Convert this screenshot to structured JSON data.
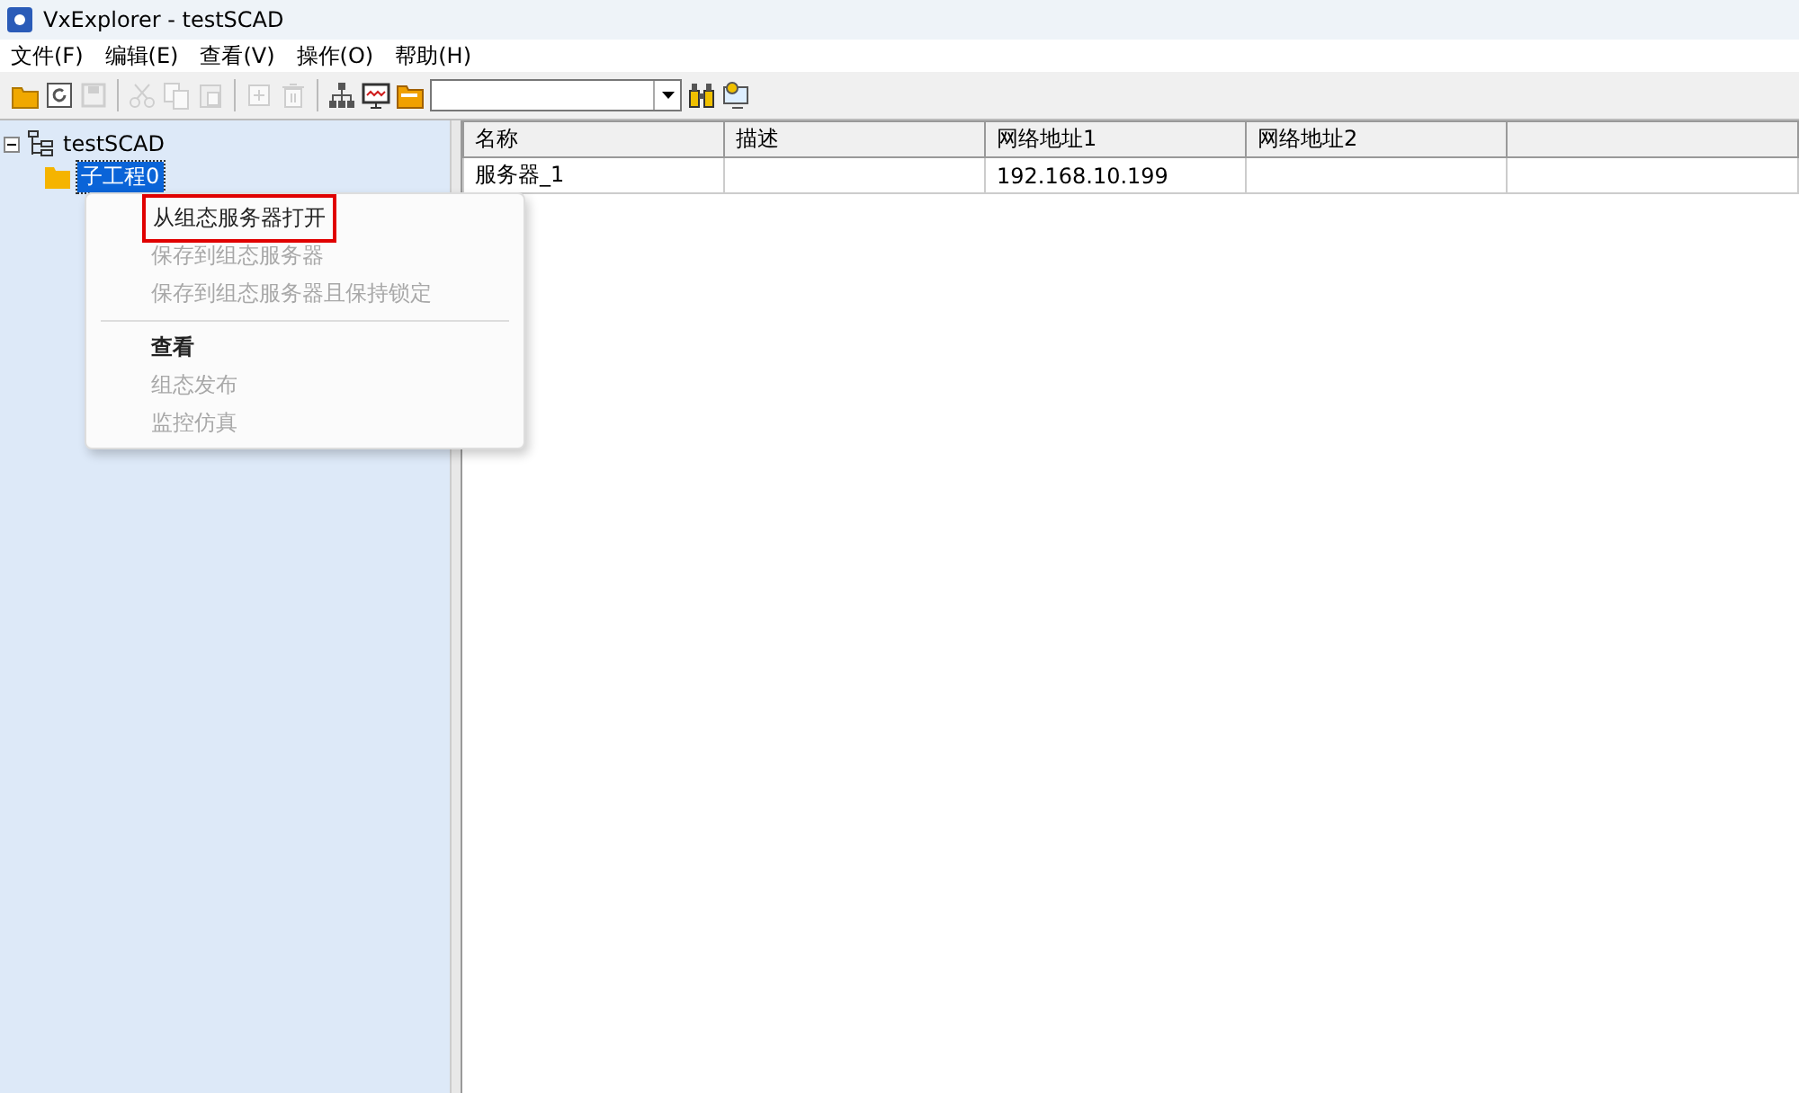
{
  "window": {
    "title": "VxExplorer - testSCAD"
  },
  "menu_bar": [
    "文件(F)",
    "编辑(E)",
    "查看(V)",
    "操作(O)",
    "帮助(H)"
  ],
  "toolbar": [
    {
      "kind": "open",
      "disabled": false
    },
    {
      "kind": "refresh",
      "disabled": false
    },
    {
      "kind": "save",
      "disabled": true
    },
    {
      "kind": "sep"
    },
    {
      "kind": "cut",
      "disabled": true
    },
    {
      "kind": "copy",
      "disabled": true
    },
    {
      "kind": "paste",
      "disabled": true
    },
    {
      "kind": "sep"
    },
    {
      "kind": "add",
      "disabled": true
    },
    {
      "kind": "delete",
      "disabled": true
    },
    {
      "kind": "sep"
    },
    {
      "kind": "network",
      "disabled": false
    },
    {
      "kind": "monitor",
      "disabled": false
    },
    {
      "kind": "folder",
      "disabled": false
    },
    {
      "kind": "combo"
    },
    {
      "kind": "binoculars",
      "disabled": false
    },
    {
      "kind": "screen",
      "disabled": false
    }
  ],
  "tree": [
    {
      "label": "testSCAD",
      "expanded": true,
      "selected": false,
      "children": [
        {
          "label": "子工程0",
          "selected": true
        }
      ]
    }
  ],
  "table": {
    "columns": [
      "名称",
      "描述",
      "网络地址1",
      "网络地址2"
    ],
    "rows": [
      [
        "服务器_1",
        "",
        "192.168.10.199",
        ""
      ]
    ]
  },
  "context_menu": [
    {
      "kind": "item",
      "label": "从组态服务器打开",
      "disabled": false,
      "bold": false,
      "highlighted": true
    },
    {
      "kind": "item",
      "label": "保存到组态服务器",
      "disabled": true,
      "bold": false,
      "highlighted": false
    },
    {
      "kind": "item",
      "label": "保存到组态服务器且保持锁定",
      "disabled": true,
      "bold": false,
      "highlighted": false
    },
    {
      "kind": "separator"
    },
    {
      "kind": "item",
      "label": "查看",
      "disabled": false,
      "bold": true,
      "highlighted": false
    },
    {
      "kind": "item",
      "label": "组态发布",
      "disabled": true,
      "bold": false,
      "highlighted": false
    },
    {
      "kind": "item",
      "label": "监控仿真",
      "disabled": true,
      "bold": false,
      "highlighted": false
    }
  ]
}
